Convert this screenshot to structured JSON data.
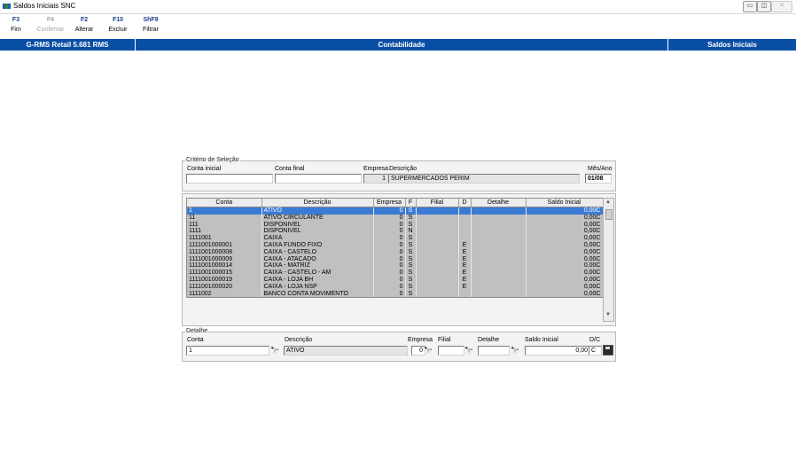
{
  "window": {
    "title": "Saldos Iniciais SNC",
    "controls": {
      "minimize": "▭",
      "restore": "◫",
      "close": "✕"
    }
  },
  "toolbar": [
    {
      "key": "F3",
      "label": "Fim",
      "enabled": true
    },
    {
      "key": "F4",
      "label": "Confirmar",
      "enabled": false
    },
    {
      "key": "F2",
      "label": "Alterar",
      "enabled": true
    },
    {
      "key": "F10",
      "label": "Excluir",
      "enabled": true
    },
    {
      "key": "ShF9",
      "label": "Filtrar",
      "enabled": true
    }
  ],
  "header_bar": {
    "left": "G-RMS Retail 5.681 RMS",
    "center": "Contabilidade",
    "right": "Saldos Iniciais",
    "color": "#0a4fa6"
  },
  "criteria": {
    "group_label": "Critério de Seleção",
    "conta_inicial_label": "Conta inicial",
    "conta_inicial_value": "",
    "conta_final_label": "Conta final",
    "conta_final_value": "",
    "empresa_label": "Empresa",
    "empresa_value": "1",
    "descricao_label": "Descrição",
    "descricao_value": "SUPERMERCADOS PERIM",
    "mes_ano_label": "Mês/Ano",
    "mes_ano_value": "01/08"
  },
  "grid": {
    "columns": [
      "Conta",
      "Descrição",
      "Empresa",
      "F",
      "Filial",
      "D",
      "Detalhe",
      "Saldo Inicial"
    ],
    "rows": [
      {
        "conta": "1",
        "descricao": "ATIVO",
        "empresa": "0",
        "f": "S",
        "filial": "",
        "d": "",
        "detalhe": "",
        "saldo": "0,00C",
        "selected": true
      },
      {
        "conta": "11",
        "descricao": "ATIVO CIRCULANTE",
        "empresa": "0",
        "f": "S",
        "filial": "",
        "d": "",
        "detalhe": "",
        "saldo": "0,00C"
      },
      {
        "conta": "111",
        "descricao": "DISPONIVEL",
        "empresa": "0",
        "f": "S",
        "filial": "",
        "d": "",
        "detalhe": "",
        "saldo": "0,00C"
      },
      {
        "conta": "1111",
        "descricao": "DISPONIVEL",
        "empresa": "0",
        "f": "N",
        "filial": "",
        "d": "",
        "detalhe": "",
        "saldo": "0,00C"
      },
      {
        "conta": "1111001",
        "descricao": "CAIXA",
        "empresa": "0",
        "f": "S",
        "filial": "",
        "d": "",
        "detalhe": "",
        "saldo": "0,00C"
      },
      {
        "conta": "1111001000001",
        "descricao": "CAIXA FUNDO FIXO",
        "empresa": "0",
        "f": "S",
        "filial": "",
        "d": "E",
        "detalhe": "",
        "saldo": "0,00C"
      },
      {
        "conta": "1111001000008",
        "descricao": "CAIXA - CASTELO",
        "empresa": "0",
        "f": "S",
        "filial": "",
        "d": "E",
        "detalhe": "",
        "saldo": "0,00C"
      },
      {
        "conta": "1111001000009",
        "descricao": "CAIXA - ATACADO",
        "empresa": "0",
        "f": "S",
        "filial": "",
        "d": "E",
        "detalhe": "",
        "saldo": "0,00C"
      },
      {
        "conta": "1111001000014",
        "descricao": "CAIXA - MATRIZ",
        "empresa": "0",
        "f": "S",
        "filial": "",
        "d": "E",
        "detalhe": "",
        "saldo": "0,00C"
      },
      {
        "conta": "1111001000015",
        "descricao": "CAIXA - CASTELO - AM",
        "empresa": "0",
        "f": "S",
        "filial": "",
        "d": "E",
        "detalhe": "",
        "saldo": "0,00C"
      },
      {
        "conta": "1111001000019",
        "descricao": "CAIXA - LOJA BH",
        "empresa": "0",
        "f": "S",
        "filial": "",
        "d": "E",
        "detalhe": "",
        "saldo": "0,00C"
      },
      {
        "conta": "1111001000020",
        "descricao": "CAIXA - LOJA NSP",
        "empresa": "0",
        "f": "S",
        "filial": "",
        "d": "E",
        "detalhe": "",
        "saldo": "0,00C"
      },
      {
        "conta": "1111002",
        "descricao": "BANCO CONTA MOVIMENTO",
        "empresa": "0",
        "f": "S",
        "filial": "",
        "d": "",
        "detalhe": "",
        "saldo": "0,00C"
      }
    ],
    "selected_color": "#3b7bd6",
    "row_color": "#c0c0c0"
  },
  "detail": {
    "group_label": "Detalhe",
    "conta_label": "Conta",
    "conta_value": "1",
    "descricao_label": "Descrição",
    "descricao_value": "ATIVO",
    "empresa_label": "Empresa",
    "empresa_value": "0",
    "filial_label": "Filial",
    "filial_value": "",
    "detalhe_label": "Detalhe",
    "detalhe_value": "",
    "saldo_label": "Saldo Inicial",
    "saldo_value": "0,00",
    "dc_label": "D/C",
    "dc_value": "C",
    "binocular_icon": "binoculars-icon",
    "save_icon": "floppy-disk-icon"
  }
}
